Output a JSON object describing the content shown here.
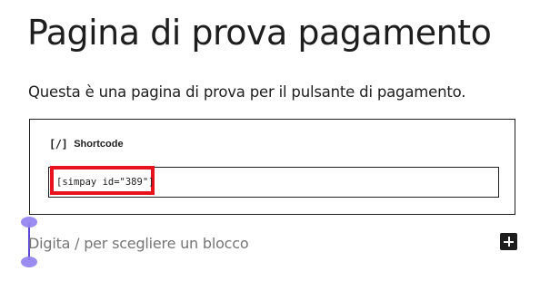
{
  "editor": {
    "title": "Pagina di prova pagamento",
    "paragraph": "Questa è una pagina di prova per il pulsante di pagamento.",
    "shortcode_block": {
      "icon_glyph": "[/]",
      "icon_name": "shortcode-icon",
      "label": "Shortcode",
      "value": "[simpay id=\"389\"]",
      "highlight_color": "#e8121d"
    },
    "appender_placeholder": "Digita / per scegliere un blocco",
    "add_block_icon": "plus-icon"
  },
  "colors": {
    "text": "#1e1e1e",
    "placeholder": "#757575",
    "caret_handle": "#8f80f0",
    "highlight": "#e8121d"
  }
}
